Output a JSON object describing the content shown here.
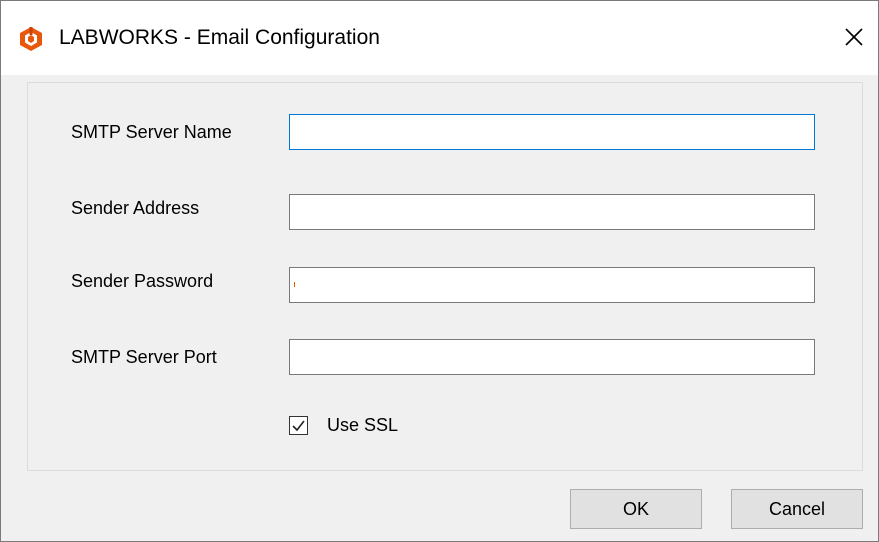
{
  "window": {
    "title": "LABWORKS - Email Configuration",
    "app_icon": "labworks-logo-icon",
    "close_icon": "close-icon",
    "accent_color": "#0078d7",
    "logo_color": "#e8580c"
  },
  "form": {
    "smtp_server_name": {
      "label": "SMTP Server Name",
      "value": ""
    },
    "sender_address": {
      "label": "Sender Address",
      "value": ""
    },
    "sender_password": {
      "label": "Sender Password",
      "value": ""
    },
    "smtp_server_port": {
      "label": "SMTP Server Port",
      "value": ""
    },
    "use_ssl": {
      "label": "Use SSL",
      "checked": true
    }
  },
  "buttons": {
    "ok": "OK",
    "cancel": "Cancel"
  }
}
